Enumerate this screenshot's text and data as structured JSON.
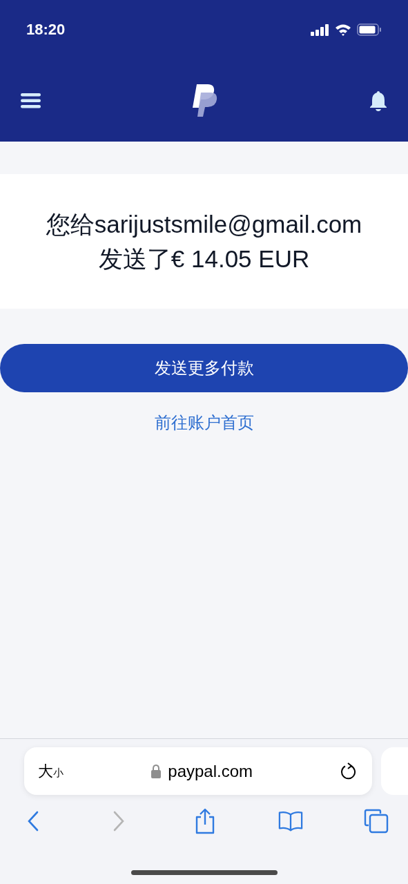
{
  "status_bar": {
    "time": "18:20"
  },
  "confirmation": {
    "lines": [
      "您给sarijustsmile@gmail.com",
      "发送了€ 14.05 EUR"
    ]
  },
  "primary_button": {
    "label": "发送更多付款"
  },
  "link": {
    "label": "前往账户首页"
  },
  "browser": {
    "text_size": "大$_{小}$",
    "url": "paypal.com",
    "toolbar": [
      {
        "kind": "back",
        "disabled": false
      },
      {
        "kind": "forward",
        "disabled": true
      },
      {
        "kind": "share",
        "disabled": false
      },
      {
        "kind": "bookmarks",
        "disabled": false
      },
      {
        "kind": "tabs",
        "disabled": false
      }
    ]
  }
}
